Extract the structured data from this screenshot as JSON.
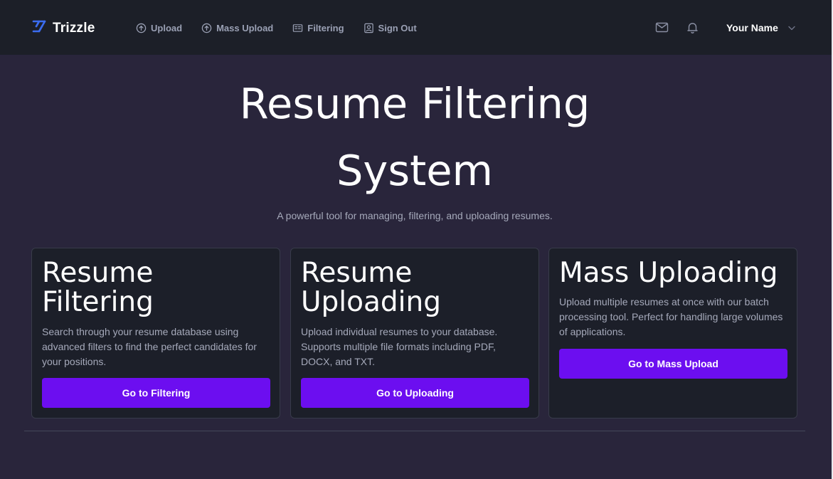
{
  "navbar": {
    "brand": "Trizzle",
    "links": [
      {
        "label": "Upload",
        "icon": "upload-circle-icon"
      },
      {
        "label": "Mass Upload",
        "icon": "upload-circle-icon"
      },
      {
        "label": "Filtering",
        "icon": "filter-list-icon"
      },
      {
        "label": "Sign Out",
        "icon": "user-square-icon"
      }
    ],
    "user_name": "Your Name"
  },
  "hero": {
    "title_line1": "Resume Filtering",
    "title_line2": "System",
    "subtitle": "A powerful tool for managing, filtering, and uploading resumes."
  },
  "cards": [
    {
      "title_line1": "Resume",
      "title_line2": "Filtering",
      "description": "Search through your resume database using advanced filters to find the perfect candidates for your positions.",
      "button": "Go to Filtering"
    },
    {
      "title_line1": "Resume",
      "title_line2": "Uploading",
      "description": "Upload individual resumes to your database. Supports multiple file formats including PDF, DOCX, and TXT.",
      "button": "Go to Uploading"
    },
    {
      "title_line1": "Mass Uploading",
      "description": "Upload multiple resumes at once with our batch processing tool. Perfect for handling large volumes of applications.",
      "button": "Go to Mass Upload"
    }
  ],
  "colors": {
    "background": "#29253b",
    "navbar": "#1c1f28",
    "card": "#1c1f29",
    "accent": "#6c0ef0",
    "logo": "#3b6cf0"
  }
}
